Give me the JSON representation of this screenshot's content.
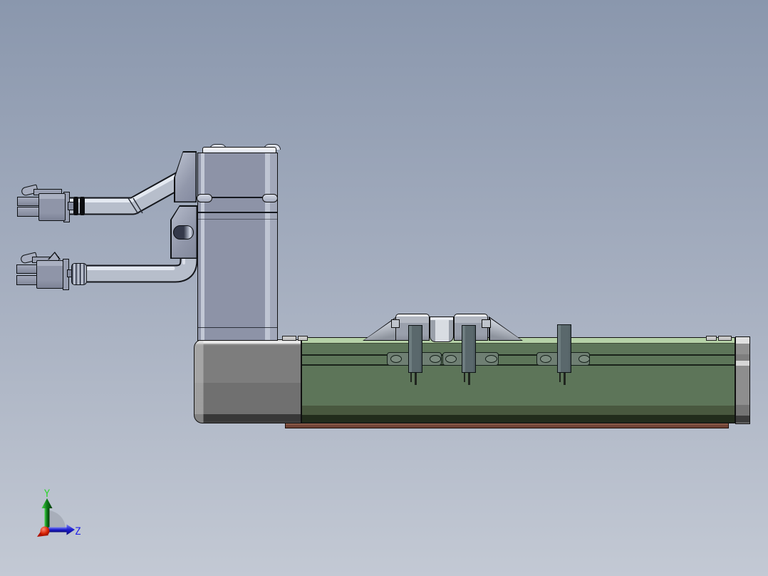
{
  "viewport": {
    "background_top": "#8a97ad",
    "background_bottom": "#c3c9d4"
  },
  "axis_triad": {
    "y_label": "Y",
    "z_label": "Z",
    "y_color": "#2fd32f",
    "z_color": "#2424e8",
    "x_origin_color": "#c81400"
  },
  "model_colors": {
    "rail_green": "#5d7559",
    "rail_top_light": "#b6d2a8",
    "base_plate_brown": "#6f4336",
    "housing_gray": "#7d7d7d",
    "end_cap_gray": "#8e8e8e",
    "metal_light": "#c2c8d6",
    "metal_mid": "#8d93a7",
    "sensor_post_slate": "#5a686c",
    "slot_plate_green_gray": "#6f7f73",
    "cable_silver": "#b7becb"
  }
}
